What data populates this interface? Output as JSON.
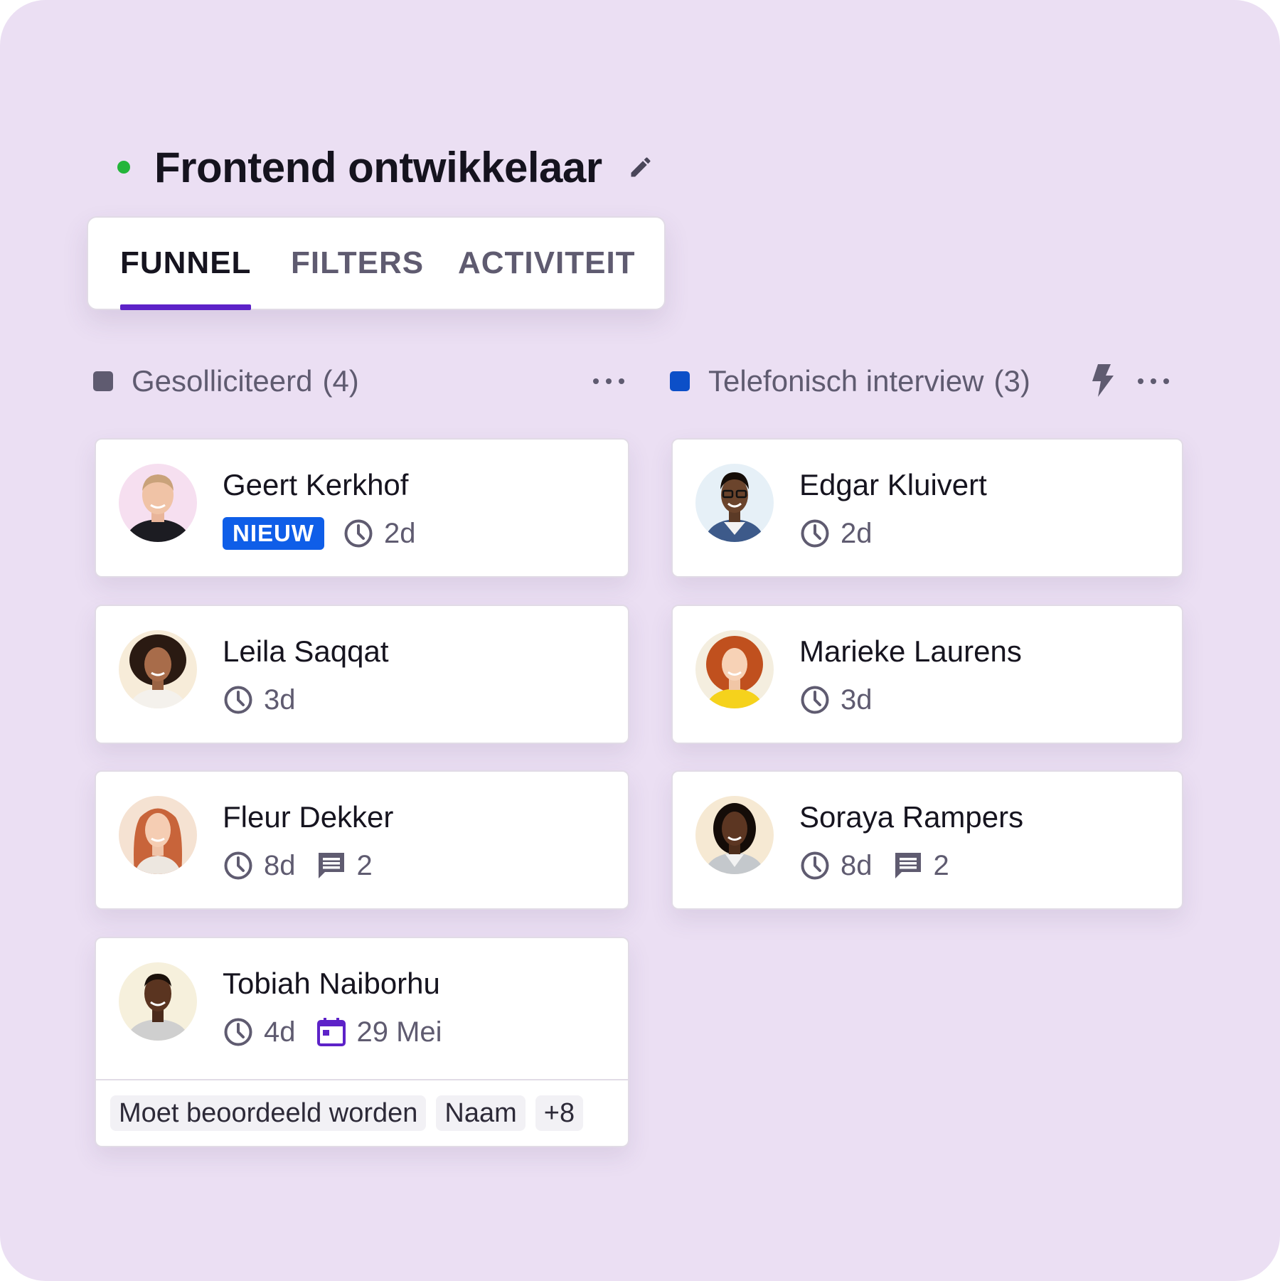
{
  "job": {
    "title": "Frontend ontwikkelaar",
    "status_color": "#24b53a"
  },
  "tabs": [
    {
      "label": "FUNNEL",
      "active": true
    },
    {
      "label": "FILTERS",
      "active": false
    },
    {
      "label": "ACTIVITEIT",
      "active": false
    }
  ],
  "colors": {
    "accent": "#5d22c8",
    "badge_blue": "#0f5ee8",
    "stage_gray": "#5f5b70",
    "stage_blue": "#0c4fc8"
  },
  "columns": [
    {
      "title": "Gesolliciteerd",
      "count": "(4)",
      "color": "#5f5b70",
      "cards": [
        {
          "name": "Geert Kerkhof",
          "badge": "NIEUW",
          "time": "2d"
        },
        {
          "name": "Leila Saqqat",
          "time": "3d"
        },
        {
          "name": "Fleur Dekker",
          "time": "8d",
          "comments": "2"
        },
        {
          "name": "Tobiah Naiborhu",
          "time": "4d",
          "date": "29 Mei",
          "tags": [
            "Moet beoordeeld worden",
            "Naam",
            "+8"
          ]
        }
      ]
    },
    {
      "title": "Telefonisch interview",
      "count": "(3)",
      "color": "#0c4fc8",
      "cards": [
        {
          "name": "Edgar Kluivert",
          "time": "2d"
        },
        {
          "name": "Marieke Laurens",
          "time": "3d"
        },
        {
          "name": "Soraya Rampers",
          "time": "8d",
          "comments": "2"
        }
      ]
    }
  ]
}
